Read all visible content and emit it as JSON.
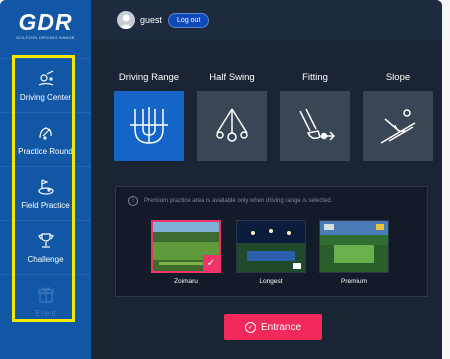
{
  "logo": {
    "text": "GDR",
    "subtitle": "GOLFZON DRIVING RANGE"
  },
  "sidebar": {
    "items": [
      {
        "label": "Driving Center",
        "icon": "driving-center-icon"
      },
      {
        "label": "Practice Round",
        "icon": "practice-round-icon"
      },
      {
        "label": "Field Practice",
        "icon": "field-practice-icon"
      },
      {
        "label": "Challenge",
        "icon": "challenge-icon"
      },
      {
        "label": "Event",
        "icon": "event-icon",
        "disabled": true
      }
    ]
  },
  "header": {
    "username": "guest",
    "logout_label": "Log out"
  },
  "modes": [
    {
      "label": "Driving Range",
      "icon": "driving-range-icon",
      "selected": true
    },
    {
      "label": "Half Swing",
      "icon": "half-swing-icon"
    },
    {
      "label": "Fitting",
      "icon": "fitting-icon"
    },
    {
      "label": "Slope",
      "icon": "slope-icon"
    }
  ],
  "premium": {
    "notice": "Premium practice area is available only when driving range is selected.",
    "courses": [
      {
        "label": "Zoimaru",
        "selected": true
      },
      {
        "label": "Longest"
      },
      {
        "label": "Premium"
      }
    ]
  },
  "entrance_label": "Entrance",
  "colors": {
    "sidebar": "#1257a6",
    "accent": "#f2295a",
    "active_tile": "#1565c8",
    "highlight": "#f5e800"
  }
}
